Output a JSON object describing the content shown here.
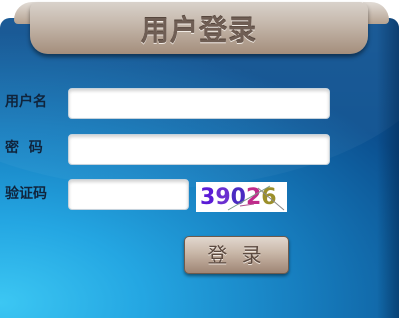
{
  "header": {
    "title": "用户登录"
  },
  "form": {
    "username_label": "用户名",
    "username_value": "",
    "password_label": "密  码",
    "password_value": "",
    "captcha_label": "验证码",
    "captcha_value": "",
    "captcha_chars": [
      "3",
      "9",
      "0",
      "2",
      "6"
    ]
  },
  "buttons": {
    "login_label": "登 录"
  },
  "colors": {
    "panel": "#1a8ad0",
    "ribbon": "#c6b9ad",
    "button": "#c8b6a7"
  }
}
